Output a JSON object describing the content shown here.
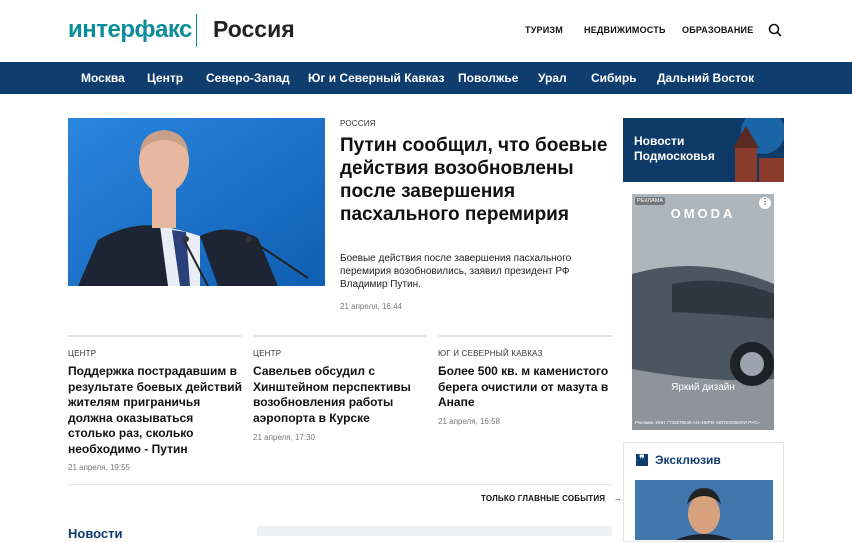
{
  "header": {
    "logo": "интерфакс",
    "region": "Россия",
    "links": [
      "ТУРИЗМ",
      "НЕДВИЖИМОСТЬ",
      "ОБРАЗОВАНИЕ"
    ]
  },
  "nav": [
    "Москва",
    "Центр",
    "Северо-Запад",
    "Юг и Северный Кавказ",
    "Поволжье",
    "Урал",
    "Сибирь",
    "Дальний Восток"
  ],
  "hero": {
    "kicker": "РОССИЯ",
    "title": "Путин сообщил, что боевые действия возобновлены после завершения пасхального перемирия",
    "lead": "Боевые действия после завершения пасхального перемирия возобновились, заявил президент РФ Владимир Путин.",
    "date": "21 апреля, 16:44"
  },
  "cards": [
    {
      "kicker": "ЦЕНТР",
      "title": "Поддержка пострадавшим в результате боевых действий жителям приграничья должна оказываться столько раз, сколько необходимо - Путин",
      "date": "21 апреля, 19:55"
    },
    {
      "kicker": "ЦЕНТР",
      "title": "Савельев обсудил с Хинштейном перспективы возобновления работы аэропорта в Курске",
      "date": "21 апреля, 17:30"
    },
    {
      "kicker": "ЮГ И СЕВЕРНЫЙ КАВКАЗ",
      "title": "Более 500 кв. м каменистого берега очистили от мазута в Анапе",
      "date": "21 апреля, 16:58"
    }
  ],
  "more_link": "ТОЛЬКО ГЛАВНЫЕ СОБЫТИЯ",
  "more_arrow": "→",
  "section_head": "Новости",
  "promo": {
    "text_line1": "Новости",
    "text_line2": "Подмосковья"
  },
  "ad": {
    "label": "РЕКЛАМА",
    "brand": "OMODA",
    "tagline": "Яркий дизайн",
    "legal": "Реклама. ИНН 7743578549 АО«ИЕРИ АВТОМОБИЛИ РУС»",
    "menu": "⋮"
  },
  "exclusive": {
    "icon": "❞",
    "title": "Эксклюзив"
  },
  "colors": {
    "brand_teal": "#0b8e9a",
    "nav_blue": "#0f3d6e"
  },
  "icons": {
    "search": "search-icon"
  }
}
